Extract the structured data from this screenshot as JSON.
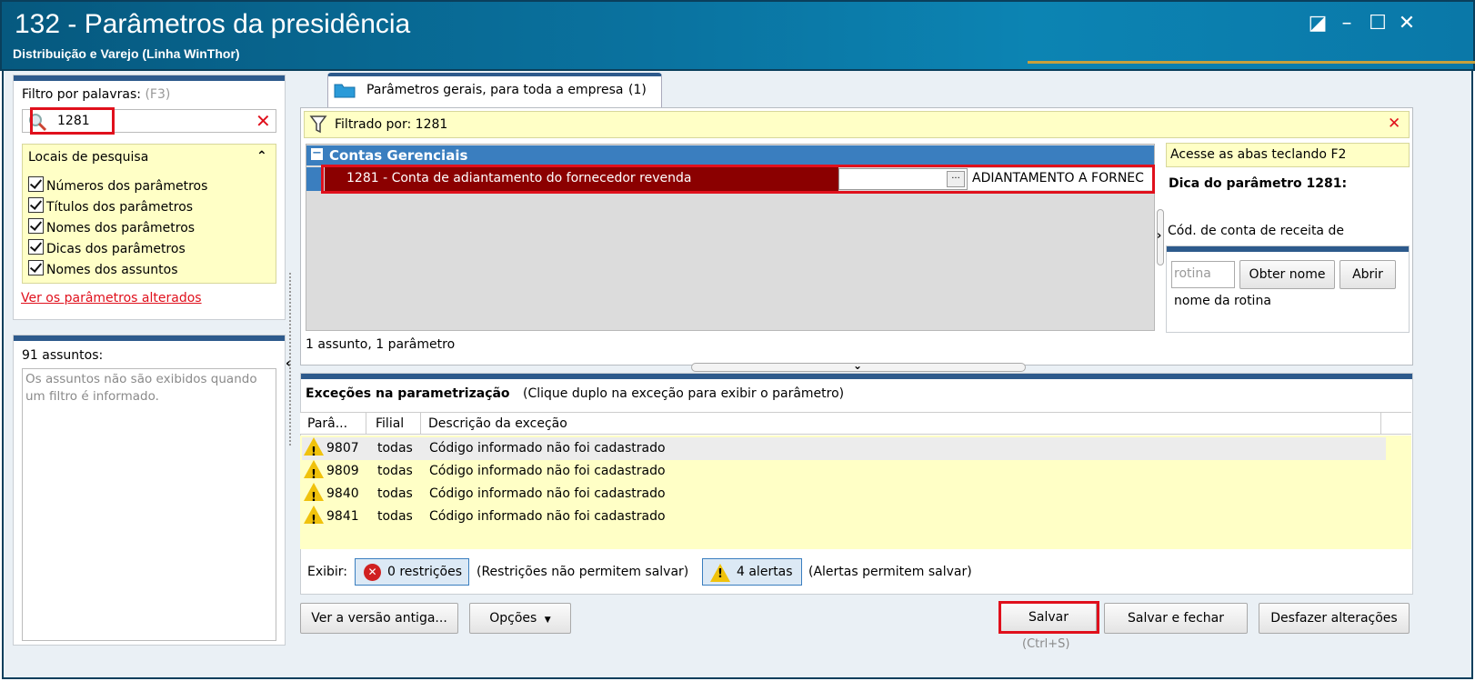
{
  "window": {
    "title": "132 - Parâmetros da presidência",
    "subtitle": "Distribuição e Varejo (Linha WinThor)",
    "controls": [
      "◪",
      "–",
      "☐",
      "✕"
    ]
  },
  "filter": {
    "label": "Filtro por palavras:",
    "shortcut": "(F3)",
    "value": "1281",
    "clear": "✕"
  },
  "locais": {
    "title": "Locais de pesquisa",
    "collapse": "⌃",
    "items": [
      {
        "label": "Números dos parâmetros",
        "checked": true
      },
      {
        "label": "Títulos dos parâmetros",
        "checked": true
      },
      {
        "label": "Nomes dos parâmetros",
        "checked": true
      },
      {
        "label": "Dicas dos parâmetros",
        "checked": true
      },
      {
        "label": "Nomes dos assuntos",
        "checked": true
      }
    ],
    "link": "Ver os parâmetros alterados"
  },
  "assuntos": {
    "count_label": "91 assuntos:",
    "message": "Os assuntos não são exibidos quando um filtro é informado."
  },
  "tab": {
    "label": "Parâmetros gerais, para toda a empresa",
    "count": "(1)"
  },
  "filtered": {
    "label": "Filtrado por: 1281",
    "clear": "✕"
  },
  "group": {
    "toggle": "−",
    "title": "Contas Gerenciais"
  },
  "param_row": {
    "label": "1281 - Conta de adiantamento do fornecedor revenda",
    "value": "",
    "ellipsis": "···",
    "description": "ADIANTAMENTO A FORNEC"
  },
  "status_line": "1 assunto, 1 parâmetro",
  "right_panel": {
    "hint_bar": "Acesse as abas teclando F2",
    "hint_title": "Dica do parâmetro 1281:",
    "hint_text": "Cód. de conta de receita de",
    "rotina_placeholder": "rotina",
    "obter_nome": "Obter nome",
    "abrir": "Abrir",
    "nome_rotina": "nome da rotina"
  },
  "excecoes": {
    "title": "Exceções na parametrização",
    "hint": "(Clique duplo na exceção para exibir o parâmetro)",
    "columns": [
      "Parâ...",
      "Filial",
      "Descrição da exceção"
    ],
    "rows": [
      {
        "param": "9807",
        "filial": "todas",
        "descricao": "Código informado não foi cadastrado"
      },
      {
        "param": "9809",
        "filial": "todas",
        "descricao": "Código informado não foi cadastrado"
      },
      {
        "param": "9840",
        "filial": "todas",
        "descricao": "Código informado não foi cadastrado"
      },
      {
        "param": "9841",
        "filial": "todas",
        "descricao": "Código informado não foi cadastrado"
      }
    ],
    "exibir_label": "Exibir:",
    "restricoes_btn": "0 restrições",
    "restricoes_note": "(Restrições não permitem salvar)",
    "alertas_btn": "4 alertas",
    "alertas_note": "(Alertas permitem salvar)"
  },
  "footer": {
    "versao_antiga": "Ver a versão antiga...",
    "opcoes": "Opções",
    "salvar": "Salvar",
    "salvar_shortcut": "(Ctrl+S)",
    "salvar_fechar": "Salvar e fechar",
    "desfazer": "Desfazer alterações"
  },
  "colors": {
    "title_bg": "#0a73a0",
    "row_selected": "#8b0000",
    "group_header": "#3a7ebf",
    "highlight_red": "#e0101c",
    "yellow_bg": "#ffffc6"
  }
}
